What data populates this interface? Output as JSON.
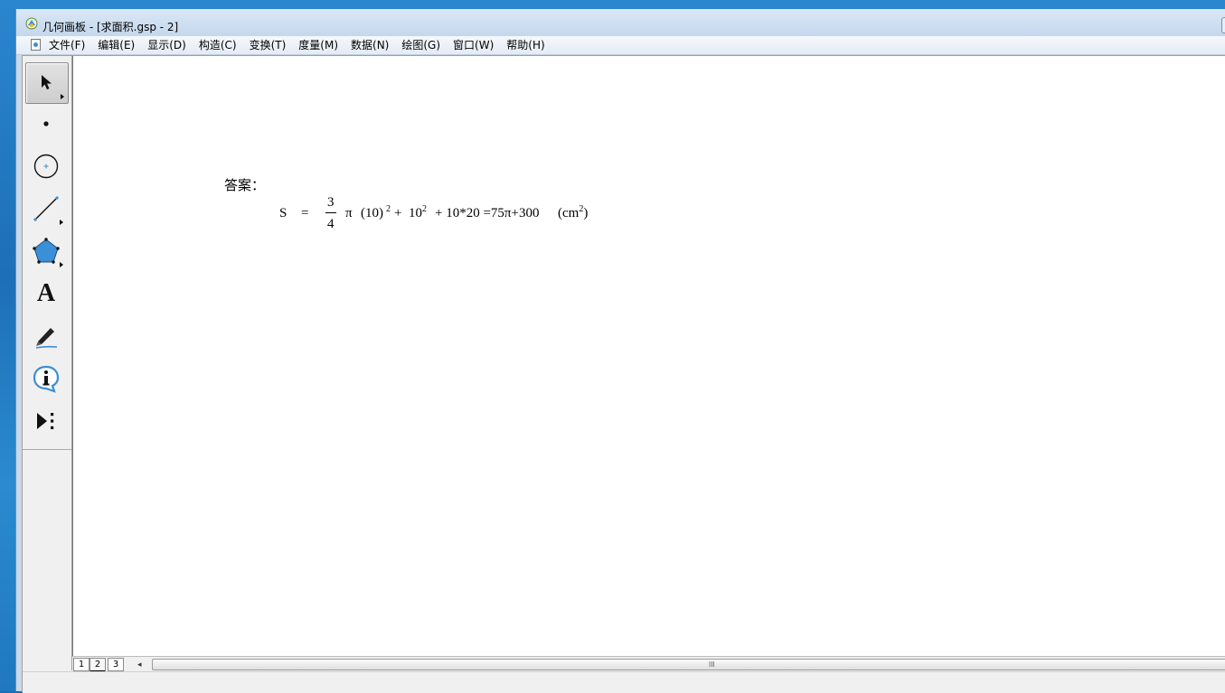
{
  "window": {
    "title": "几何画板 - [求面积.gsp - 2]"
  },
  "menu": {
    "items": [
      {
        "label": "文件(F)"
      },
      {
        "label": "编辑(E)"
      },
      {
        "label": "显示(D)"
      },
      {
        "label": "构造(C)"
      },
      {
        "label": "变换(T)"
      },
      {
        "label": "度量(M)"
      },
      {
        "label": "数据(N)"
      },
      {
        "label": "绘图(G)"
      },
      {
        "label": "窗口(W)"
      },
      {
        "label": "帮助(H)"
      }
    ]
  },
  "toolbox": {
    "tools": [
      {
        "name": "arrow-select-icon",
        "active": true
      },
      {
        "name": "point-icon"
      },
      {
        "name": "compass-circle-icon"
      },
      {
        "name": "straightedge-icon"
      },
      {
        "name": "polygon-icon"
      },
      {
        "name": "text-icon",
        "glyph": "A"
      },
      {
        "name": "marker-pen-icon"
      },
      {
        "name": "information-icon"
      },
      {
        "name": "custom-tool-icon"
      }
    ]
  },
  "canvas": {
    "answer_label": "答案：",
    "formula": {
      "lhs": "S",
      "equals": "=",
      "frac_num": "3",
      "frac_den": "4",
      "pi": "π",
      "term1": "(10)",
      "exp1": "2",
      "plus1": "+",
      "term2": "10",
      "exp2": "2",
      "rest": "+ 10*20 =75π+300",
      "unit_open": "(cm",
      "unit_exp": "2",
      "unit_close": ")"
    }
  },
  "pages": {
    "tabs": [
      "1",
      "2",
      "3"
    ],
    "selected": "2",
    "scroll_left_glyph": "◂",
    "scroll_grip": "III"
  },
  "colors": {
    "tool_blue": "#3a8fd6",
    "canvas_bg": "#ffffff",
    "chrome_bg": "#f0f0f0"
  }
}
